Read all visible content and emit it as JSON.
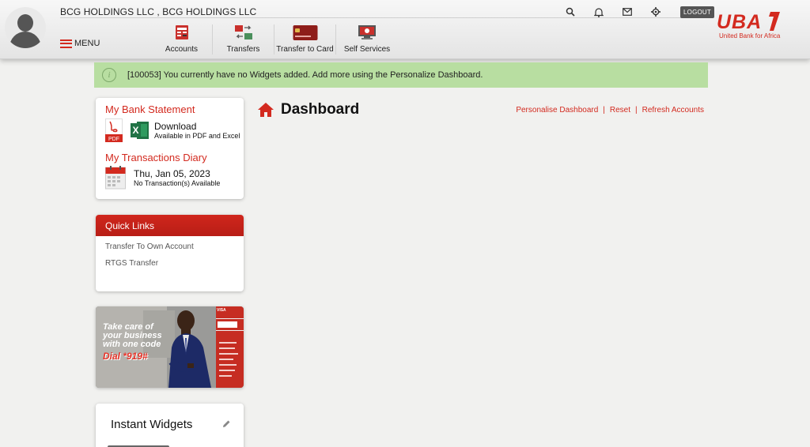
{
  "header": {
    "company": "BCG HOLDINGS LLC , BCG HOLDINGS LLC",
    "menu_label": "MENU",
    "logout_label": "LOGOUT",
    "top_icons": [
      "search-icon",
      "bell-icon",
      "mail-icon",
      "gear-icon"
    ],
    "nav": [
      {
        "label": "Accounts",
        "icon": "accounts-icon"
      },
      {
        "label": "Transfers",
        "icon": "transfers-icon"
      },
      {
        "label": "Transfer to Card",
        "icon": "card-icon"
      },
      {
        "label": "Self Services",
        "icon": "self-services-icon"
      }
    ],
    "brand": {
      "name": "UBA",
      "tagline": "United Bank for Africa",
      "color": "#d32a1f"
    }
  },
  "notice": {
    "text": "[100053] You currently have no Widgets added. Add more using the Personalize Dashboard."
  },
  "statement": {
    "title": "My Bank Statement",
    "download_label": "Download",
    "download_sub": "Available in PDF and Excel",
    "pdf_label": "PDF",
    "excel_label": "X"
  },
  "diary": {
    "title": "My Transactions Diary",
    "date": "Thu, Jan 05, 2023",
    "status": "No Transaction(s) Available"
  },
  "quick_links": {
    "title": "Quick Links",
    "items": [
      "Transfer To Own Account",
      "RTGS Transfer"
    ]
  },
  "banner": {
    "line1": "Take care of",
    "line2": "your business",
    "line3": "with one code",
    "dial": "Dial *919#",
    "tag": "VISA"
  },
  "instant_widgets": {
    "title": "Instant Widgets"
  },
  "dashboard": {
    "title": "Dashboard",
    "links": [
      "Personalise Dashboard",
      "Reset",
      "Refresh Accounts"
    ],
    "separator": "|"
  }
}
